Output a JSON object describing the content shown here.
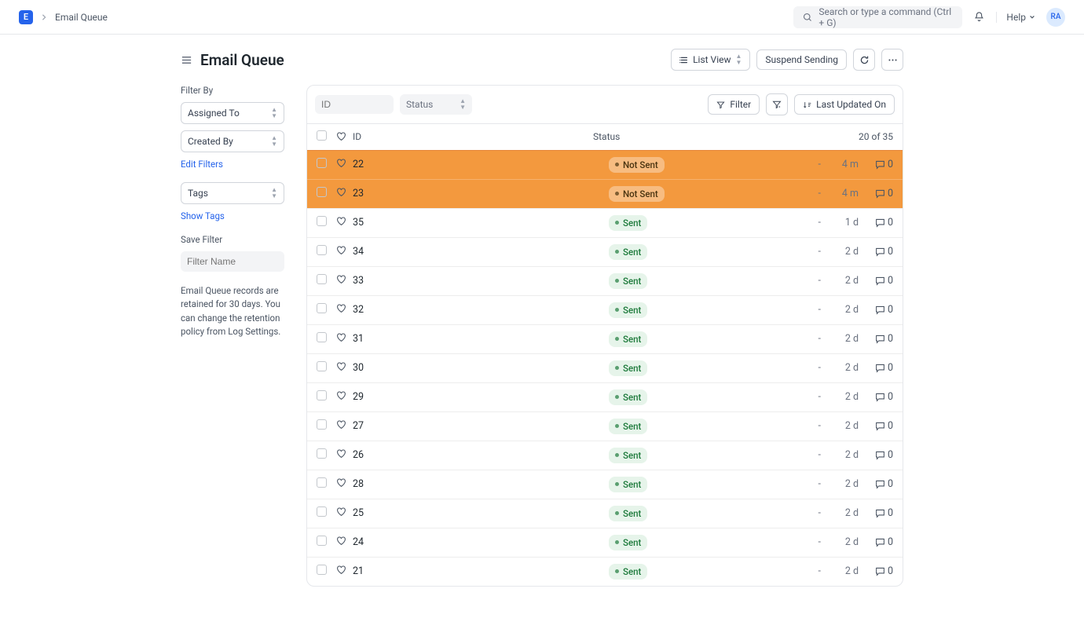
{
  "app": {
    "logo_letter": "E",
    "breadcrumb": "Email Queue",
    "search_placeholder": "Search or type a command (Ctrl + G)",
    "help_label": "Help",
    "avatar_initials": "RA"
  },
  "page": {
    "title": "Email Queue"
  },
  "header_actions": {
    "view_label": "List View",
    "suspend_label": "Suspend Sending"
  },
  "sidebar": {
    "filter_by_heading": "Filter By",
    "assigned_to": "Assigned To",
    "created_by": "Created By",
    "edit_filters": "Edit Filters",
    "tags": "Tags",
    "show_tags": "Show Tags",
    "save_filter_heading": "Save Filter",
    "filter_name_placeholder": "Filter Name",
    "retention_note": "Email Queue records are retained for 30 days. You can change the retention policy from Log Settings."
  },
  "toolbar": {
    "id_placeholder": "ID",
    "status_label": "Status",
    "filter_label": "Filter",
    "sort_label": "Last Updated On"
  },
  "table": {
    "id_header": "ID",
    "status_header": "Status",
    "count_text": "20 of 35",
    "rows": [
      {
        "id": "22",
        "status": "Not Sent",
        "status_kind": "notsent",
        "time": "4 m",
        "comments": "0",
        "highlight": true
      },
      {
        "id": "23",
        "status": "Not Sent",
        "status_kind": "notsent",
        "time": "4 m",
        "comments": "0",
        "highlight": true
      },
      {
        "id": "35",
        "status": "Sent",
        "status_kind": "sent",
        "time": "1 d",
        "comments": "0",
        "highlight": false
      },
      {
        "id": "34",
        "status": "Sent",
        "status_kind": "sent",
        "time": "2 d",
        "comments": "0",
        "highlight": false
      },
      {
        "id": "33",
        "status": "Sent",
        "status_kind": "sent",
        "time": "2 d",
        "comments": "0",
        "highlight": false
      },
      {
        "id": "32",
        "status": "Sent",
        "status_kind": "sent",
        "time": "2 d",
        "comments": "0",
        "highlight": false
      },
      {
        "id": "31",
        "status": "Sent",
        "status_kind": "sent",
        "time": "2 d",
        "comments": "0",
        "highlight": false
      },
      {
        "id": "30",
        "status": "Sent",
        "status_kind": "sent",
        "time": "2 d",
        "comments": "0",
        "highlight": false
      },
      {
        "id": "29",
        "status": "Sent",
        "status_kind": "sent",
        "time": "2 d",
        "comments": "0",
        "highlight": false
      },
      {
        "id": "27",
        "status": "Sent",
        "status_kind": "sent",
        "time": "2 d",
        "comments": "0",
        "highlight": false
      },
      {
        "id": "26",
        "status": "Sent",
        "status_kind": "sent",
        "time": "2 d",
        "comments": "0",
        "highlight": false
      },
      {
        "id": "28",
        "status": "Sent",
        "status_kind": "sent",
        "time": "2 d",
        "comments": "0",
        "highlight": false
      },
      {
        "id": "25",
        "status": "Sent",
        "status_kind": "sent",
        "time": "2 d",
        "comments": "0",
        "highlight": false
      },
      {
        "id": "24",
        "status": "Sent",
        "status_kind": "sent",
        "time": "2 d",
        "comments": "0",
        "highlight": false
      },
      {
        "id": "21",
        "status": "Sent",
        "status_kind": "sent",
        "time": "2 d",
        "comments": "0",
        "highlight": false
      }
    ]
  }
}
